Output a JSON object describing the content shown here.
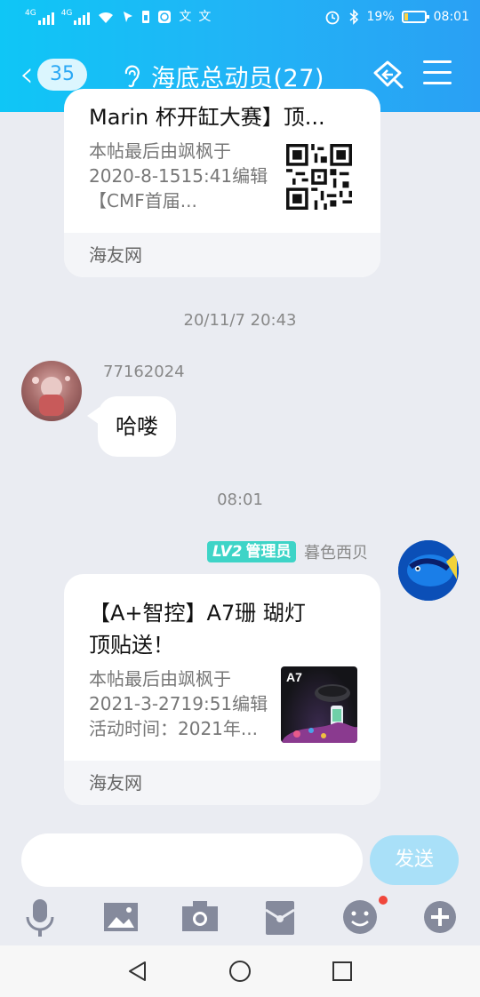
{
  "status_bar": {
    "net_left": "4G",
    "net_right": "4G",
    "extra_glyphs": [
      "文",
      "文"
    ],
    "battery_percent": "19%",
    "battery_level": 0.19,
    "time": "08:01"
  },
  "nav": {
    "unread_count": "35",
    "title": "海底总动员(27)"
  },
  "messages": {
    "card1": {
      "title": "Marin 杯开缸大赛】顶...",
      "desc_lines": [
        "本帖最后由飒枫于",
        "2020-8-1515:41编辑",
        "【CMF首届..."
      ],
      "source": "海友网"
    },
    "timestamp1": "20/11/7 20:43",
    "msg1": {
      "sender": "77162024",
      "text": "哈喽"
    },
    "timestamp2": "08:01",
    "msg2": {
      "badge_level": "LV2",
      "badge_role": "管理员",
      "sender": "暮色西贝",
      "title_lines": [
        "【A+智控】A7珊 瑚灯",
        "顶贴送！"
      ],
      "desc_lines": [
        "本帖最后由飒枫于",
        "2021-3-2719:51编辑",
        "活动时间：2021年..."
      ],
      "thumb_label": "A7",
      "source": "海友网"
    }
  },
  "input": {
    "placeholder": "",
    "send_label": "发送"
  },
  "toolbar": {
    "icons": [
      "microphone-icon",
      "image-icon",
      "camera-icon",
      "red-packet-icon",
      "emoji-icon",
      "plus-icon"
    ],
    "emoji_has_notification": true
  },
  "colors": {
    "header_start": "#0fc6f6",
    "header_end": "#2aa0f4",
    "send_button": "#a9e0f8",
    "badge": "#3ed4c7",
    "notification_dot": "#f0473c"
  }
}
